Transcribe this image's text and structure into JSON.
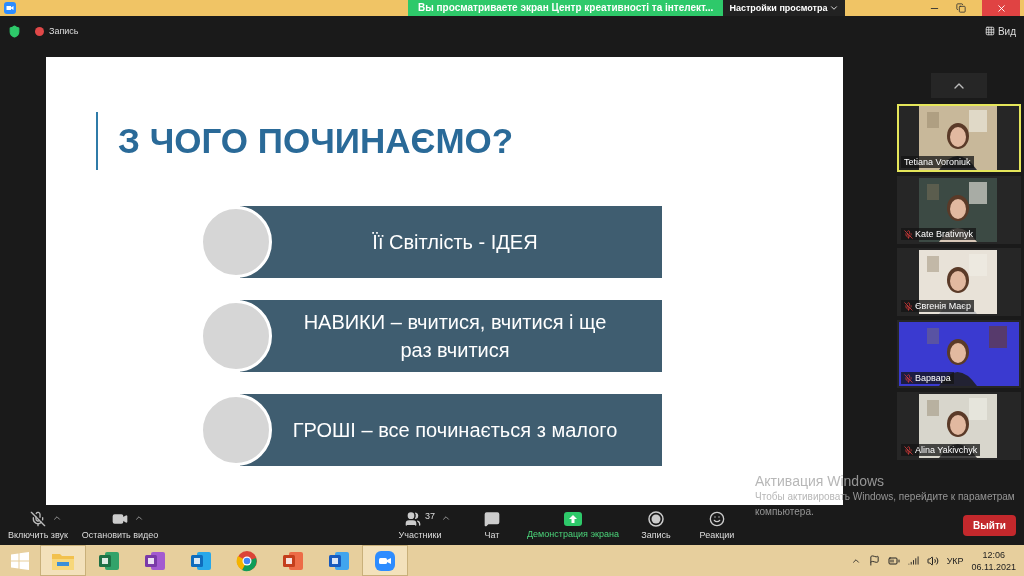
{
  "title_bar": {
    "banner": "Вы просматриваете экран Центр креативності та інтелект...",
    "view_options": "Настройки просмотра"
  },
  "meeting_bar": {
    "record": "Запись",
    "view": "Вид"
  },
  "slide": {
    "title": "З ЧОГО ПОЧИНАЄМО?",
    "items": [
      {
        "text": "Її Світлість - ІДЕЯ"
      },
      {
        "text": "НАВИКИ – вчитися, вчитися і ще раз вчитися"
      },
      {
        "text": "ГРОШІ – все починається з малого"
      }
    ]
  },
  "gallery": {
    "tiles": [
      {
        "name": "Tetiana Voroniuk",
        "muted": false,
        "speaking": true
      },
      {
        "name": "Kate Brativnyk",
        "muted": true,
        "speaking": false
      },
      {
        "name": "Євгенія Маєр",
        "muted": true,
        "speaking": false
      },
      {
        "name": "Варвара",
        "muted": true,
        "speaking": false
      },
      {
        "name": "Alina Yakivchyk",
        "muted": true,
        "speaking": false
      }
    ]
  },
  "toolbar": {
    "items": [
      {
        "kind": "mic",
        "label": "Включить звук",
        "caret": true
      },
      {
        "kind": "video",
        "label": "Остановить видео",
        "caret": true
      },
      {
        "kind": "participants",
        "label": "Участники",
        "count": "37",
        "caret": true
      },
      {
        "kind": "chat",
        "label": "Чат",
        "caret": false
      },
      {
        "kind": "share",
        "label": "Демонстрация экрана",
        "caret": false
      },
      {
        "kind": "record",
        "label": "Запись",
        "caret": false
      },
      {
        "kind": "reactions",
        "label": "Реакции",
        "caret": false
      }
    ],
    "leave": "Выйти"
  },
  "activation": {
    "title": "Активация Windows",
    "text": "Чтобы активировать Windows, перейдите к параметрам компьютера."
  },
  "taskbar": {
    "apps": [
      {
        "kind": "explorer",
        "selected": true
      },
      {
        "kind": "excel",
        "selected": false
      },
      {
        "kind": "onenote",
        "selected": false
      },
      {
        "kind": "outlook",
        "selected": false
      },
      {
        "kind": "chrome",
        "selected": false
      },
      {
        "kind": "powerpoint",
        "selected": false
      },
      {
        "kind": "word",
        "selected": false
      },
      {
        "kind": "zoom",
        "selected": true
      }
    ],
    "language": "УКР",
    "time": "12:06",
    "date": "06.11.2021"
  }
}
